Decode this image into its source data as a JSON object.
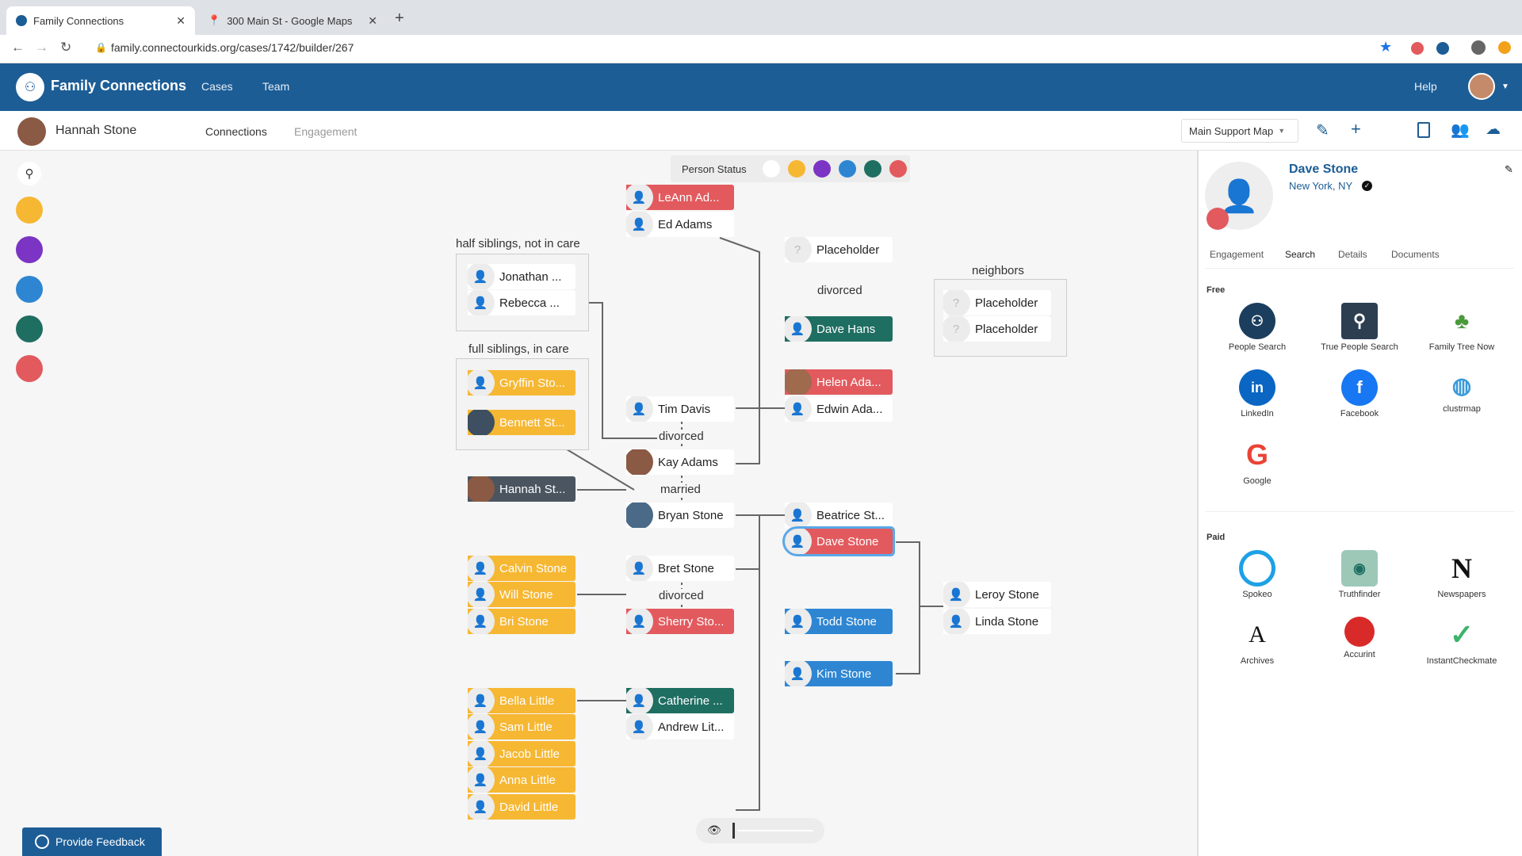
{
  "browser": {
    "tabs": [
      {
        "title": "Family Connections"
      },
      {
        "title": "300 Main St - Google Maps"
      }
    ],
    "url": "family.connectourkids.org/cases/1742/builder/267"
  },
  "app": {
    "title": "Family Connections",
    "nav": [
      "Cases",
      "Team"
    ],
    "help": "Help"
  },
  "case": {
    "person": "Hannah Stone",
    "tabs": [
      "Connections",
      "Engagement"
    ],
    "map_select": "Main Support Map"
  },
  "colors": {
    "yellow": "#f6b733",
    "purple": "#7b34c3",
    "blue": "#2e86d3",
    "green": "#1f6e62",
    "red": "#e25a5e",
    "header": "#1c5d96"
  },
  "legend": {
    "label": "Person Status"
  },
  "groups": {
    "half": "half siblings, not in care",
    "full": "full siblings, in care",
    "neighbors": "neighbors"
  },
  "relations": {
    "divorced": "divorced",
    "married": "married"
  },
  "nodes": {
    "leann": "LeAnn Ad...",
    "ed": "Ed Adams",
    "jonathan": "Jonathan ...",
    "rebecca": "Rebecca ...",
    "gryffin": "Gryffin Sto...",
    "bennett": "Bennett St...",
    "hannah": "Hannah St...",
    "tim": "Tim Davis",
    "kay": "Kay Adams",
    "bryan": "Bryan Stone",
    "placeholder": "Placeholder",
    "davehans": "Dave Hans",
    "helen": "Helen Ada...",
    "edwin": "Edwin Ada...",
    "beatrice": "Beatrice St...",
    "davestone": "Dave Stone",
    "calvin": "Calvin Stone",
    "will": "Will Stone",
    "bri": "Bri Stone",
    "bret": "Bret Stone",
    "sherry": "Sherry Sto...",
    "todd": "Todd Stone",
    "kim": "Kim Stone",
    "leroy": "Leroy Stone",
    "linda": "Linda Stone",
    "bella": "Bella Little",
    "sam": "Sam Little",
    "jacob": "Jacob Little",
    "anna": "Anna Little",
    "david": "David Little",
    "catherine": "Catherine ...",
    "andrew": "Andrew Lit..."
  },
  "panel": {
    "name": "Dave Stone",
    "location": "New York, NY",
    "tabs": [
      "Engagement",
      "Search",
      "Details",
      "Documents"
    ],
    "free_label": "Free",
    "paid_label": "Paid",
    "free": [
      {
        "label": "People Search",
        "icon": "people-search-icon"
      },
      {
        "label": "True People Search",
        "icon": "magnifier-icon"
      },
      {
        "label": "Family Tree Now",
        "icon": "tree-icon"
      },
      {
        "label": "LinkedIn",
        "icon": "linkedin-icon"
      },
      {
        "label": "Facebook",
        "icon": "facebook-icon"
      },
      {
        "label": "clustrmap",
        "icon": "globe-icon"
      },
      {
        "label": "Google",
        "icon": "google-icon"
      }
    ],
    "paid": [
      {
        "label": "Spokeo",
        "icon": "spokeo-icon"
      },
      {
        "label": "Truthfinder",
        "icon": "truthfinder-icon"
      },
      {
        "label": "Newspapers",
        "icon": "newspapers-icon"
      },
      {
        "label": "Archives",
        "icon": "archives-icon"
      },
      {
        "label": "Accurint",
        "icon": "accurint-icon"
      },
      {
        "label": "InstantCheckmate",
        "icon": "checkmark-icon"
      }
    ]
  },
  "feedback": "Provide Feedback"
}
